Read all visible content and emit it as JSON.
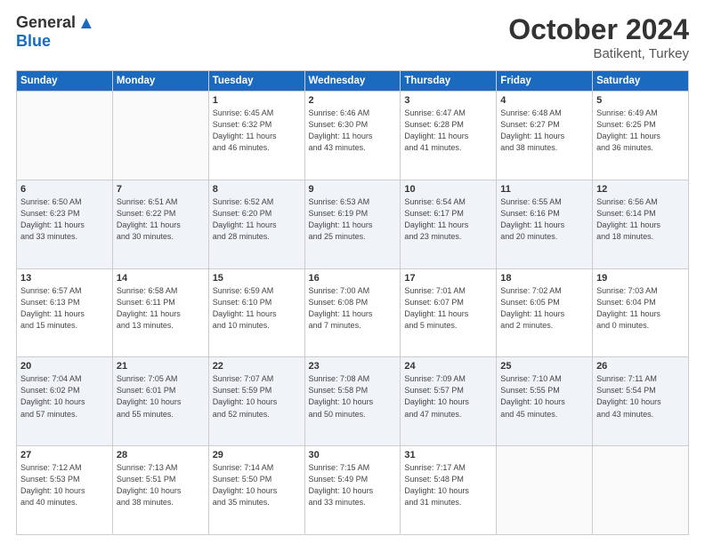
{
  "header": {
    "logo_general": "General",
    "logo_blue": "Blue",
    "month": "October 2024",
    "location": "Batikent, Turkey"
  },
  "weekdays": [
    "Sunday",
    "Monday",
    "Tuesday",
    "Wednesday",
    "Thursday",
    "Friday",
    "Saturday"
  ],
  "weeks": [
    [
      {
        "day": "",
        "detail": ""
      },
      {
        "day": "",
        "detail": ""
      },
      {
        "day": "1",
        "detail": "Sunrise: 6:45 AM\nSunset: 6:32 PM\nDaylight: 11 hours\nand 46 minutes."
      },
      {
        "day": "2",
        "detail": "Sunrise: 6:46 AM\nSunset: 6:30 PM\nDaylight: 11 hours\nand 43 minutes."
      },
      {
        "day": "3",
        "detail": "Sunrise: 6:47 AM\nSunset: 6:28 PM\nDaylight: 11 hours\nand 41 minutes."
      },
      {
        "day": "4",
        "detail": "Sunrise: 6:48 AM\nSunset: 6:27 PM\nDaylight: 11 hours\nand 38 minutes."
      },
      {
        "day": "5",
        "detail": "Sunrise: 6:49 AM\nSunset: 6:25 PM\nDaylight: 11 hours\nand 36 minutes."
      }
    ],
    [
      {
        "day": "6",
        "detail": "Sunrise: 6:50 AM\nSunset: 6:23 PM\nDaylight: 11 hours\nand 33 minutes."
      },
      {
        "day": "7",
        "detail": "Sunrise: 6:51 AM\nSunset: 6:22 PM\nDaylight: 11 hours\nand 30 minutes."
      },
      {
        "day": "8",
        "detail": "Sunrise: 6:52 AM\nSunset: 6:20 PM\nDaylight: 11 hours\nand 28 minutes."
      },
      {
        "day": "9",
        "detail": "Sunrise: 6:53 AM\nSunset: 6:19 PM\nDaylight: 11 hours\nand 25 minutes."
      },
      {
        "day": "10",
        "detail": "Sunrise: 6:54 AM\nSunset: 6:17 PM\nDaylight: 11 hours\nand 23 minutes."
      },
      {
        "day": "11",
        "detail": "Sunrise: 6:55 AM\nSunset: 6:16 PM\nDaylight: 11 hours\nand 20 minutes."
      },
      {
        "day": "12",
        "detail": "Sunrise: 6:56 AM\nSunset: 6:14 PM\nDaylight: 11 hours\nand 18 minutes."
      }
    ],
    [
      {
        "day": "13",
        "detail": "Sunrise: 6:57 AM\nSunset: 6:13 PM\nDaylight: 11 hours\nand 15 minutes."
      },
      {
        "day": "14",
        "detail": "Sunrise: 6:58 AM\nSunset: 6:11 PM\nDaylight: 11 hours\nand 13 minutes."
      },
      {
        "day": "15",
        "detail": "Sunrise: 6:59 AM\nSunset: 6:10 PM\nDaylight: 11 hours\nand 10 minutes."
      },
      {
        "day": "16",
        "detail": "Sunrise: 7:00 AM\nSunset: 6:08 PM\nDaylight: 11 hours\nand 7 minutes."
      },
      {
        "day": "17",
        "detail": "Sunrise: 7:01 AM\nSunset: 6:07 PM\nDaylight: 11 hours\nand 5 minutes."
      },
      {
        "day": "18",
        "detail": "Sunrise: 7:02 AM\nSunset: 6:05 PM\nDaylight: 11 hours\nand 2 minutes."
      },
      {
        "day": "19",
        "detail": "Sunrise: 7:03 AM\nSunset: 6:04 PM\nDaylight: 11 hours\nand 0 minutes."
      }
    ],
    [
      {
        "day": "20",
        "detail": "Sunrise: 7:04 AM\nSunset: 6:02 PM\nDaylight: 10 hours\nand 57 minutes."
      },
      {
        "day": "21",
        "detail": "Sunrise: 7:05 AM\nSunset: 6:01 PM\nDaylight: 10 hours\nand 55 minutes."
      },
      {
        "day": "22",
        "detail": "Sunrise: 7:07 AM\nSunset: 5:59 PM\nDaylight: 10 hours\nand 52 minutes."
      },
      {
        "day": "23",
        "detail": "Sunrise: 7:08 AM\nSunset: 5:58 PM\nDaylight: 10 hours\nand 50 minutes."
      },
      {
        "day": "24",
        "detail": "Sunrise: 7:09 AM\nSunset: 5:57 PM\nDaylight: 10 hours\nand 47 minutes."
      },
      {
        "day": "25",
        "detail": "Sunrise: 7:10 AM\nSunset: 5:55 PM\nDaylight: 10 hours\nand 45 minutes."
      },
      {
        "day": "26",
        "detail": "Sunrise: 7:11 AM\nSunset: 5:54 PM\nDaylight: 10 hours\nand 43 minutes."
      }
    ],
    [
      {
        "day": "27",
        "detail": "Sunrise: 7:12 AM\nSunset: 5:53 PM\nDaylight: 10 hours\nand 40 minutes."
      },
      {
        "day": "28",
        "detail": "Sunrise: 7:13 AM\nSunset: 5:51 PM\nDaylight: 10 hours\nand 38 minutes."
      },
      {
        "day": "29",
        "detail": "Sunrise: 7:14 AM\nSunset: 5:50 PM\nDaylight: 10 hours\nand 35 minutes."
      },
      {
        "day": "30",
        "detail": "Sunrise: 7:15 AM\nSunset: 5:49 PM\nDaylight: 10 hours\nand 33 minutes."
      },
      {
        "day": "31",
        "detail": "Sunrise: 7:17 AM\nSunset: 5:48 PM\nDaylight: 10 hours\nand 31 minutes."
      },
      {
        "day": "",
        "detail": ""
      },
      {
        "day": "",
        "detail": ""
      }
    ]
  ]
}
